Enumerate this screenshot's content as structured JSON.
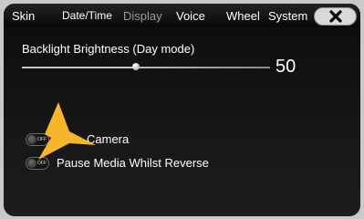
{
  "tabs": [
    {
      "label": "Skin",
      "active": true
    },
    {
      "label": "Date/Time",
      "active": true
    },
    {
      "label": "Display",
      "active": false
    },
    {
      "label": "Voice",
      "active": true
    },
    {
      "label": "Wheel",
      "active": true
    },
    {
      "label": "System",
      "active": true
    }
  ],
  "close_icon": "close-x-icon",
  "brightness": {
    "label": "Backlight Brightness (Day mode)",
    "value": "50",
    "level_fraction": 0.46
  },
  "toggles": [
    {
      "label": "Camera",
      "state": "OFF"
    },
    {
      "label": "Pause Media Whilst Reverse",
      "state": "OFF"
    }
  ],
  "overlay": {
    "icon": "pointer-arrow-icon",
    "color": "#f7b52c"
  },
  "colors": {
    "accent": "#f7b52c",
    "background": "#121212",
    "text": "#ffffff"
  }
}
